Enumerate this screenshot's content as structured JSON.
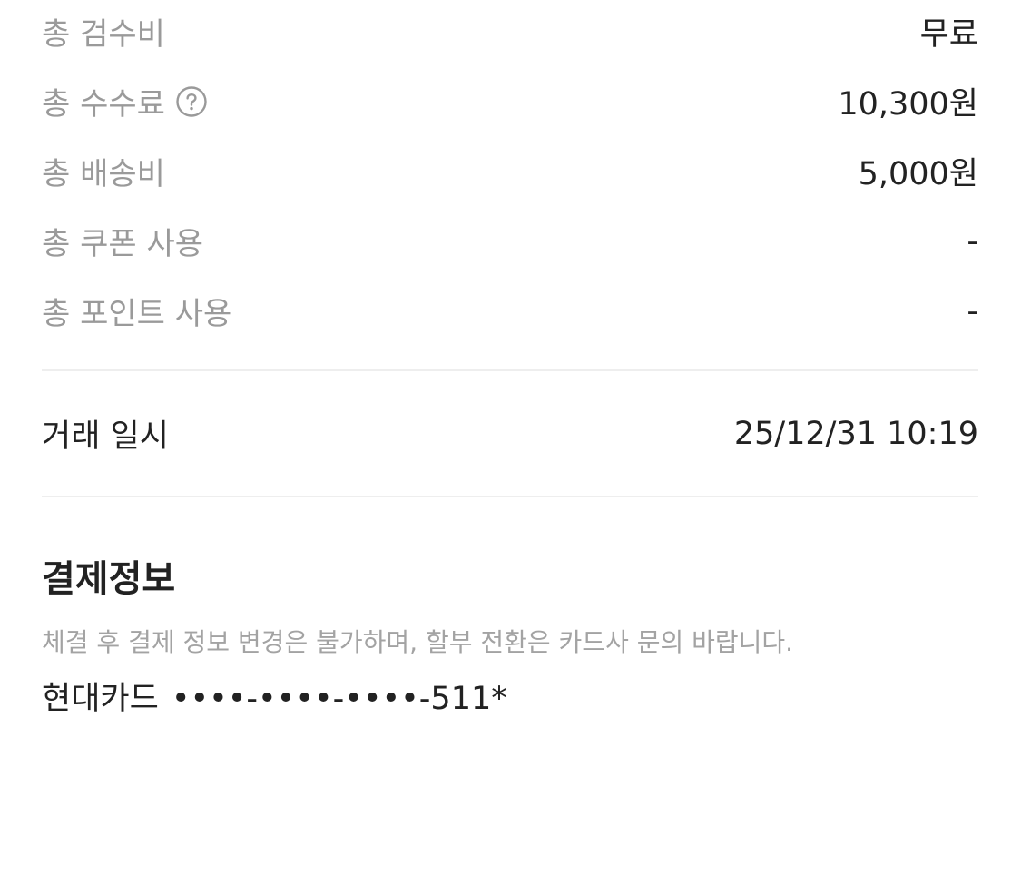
{
  "fees": [
    {
      "label": "총 검수비",
      "value": "무료"
    },
    {
      "label": "총 수수료",
      "value": "10,300원",
      "help_icon": "question-circle-icon"
    },
    {
      "label": "총 배송비",
      "value": "5,000원"
    },
    {
      "label": "총 쿠폰 사용",
      "value": "-"
    },
    {
      "label": "총 포인트 사용",
      "value": "-"
    }
  ],
  "transaction": {
    "label": "거래 일시",
    "value": "25/12/31 10:19"
  },
  "payment": {
    "title": "결제정보",
    "notice": "체결 후 결제 정보 변경은 불가하며, 할부 전환은 카드사 문의 바랍니다.",
    "card_name": "현대카드",
    "card_number": "••••-••••-••••-511*"
  },
  "colors": {
    "label_gray": "#9a9a9a",
    "text_dark": "#222222",
    "divider": "#eeeeee"
  }
}
